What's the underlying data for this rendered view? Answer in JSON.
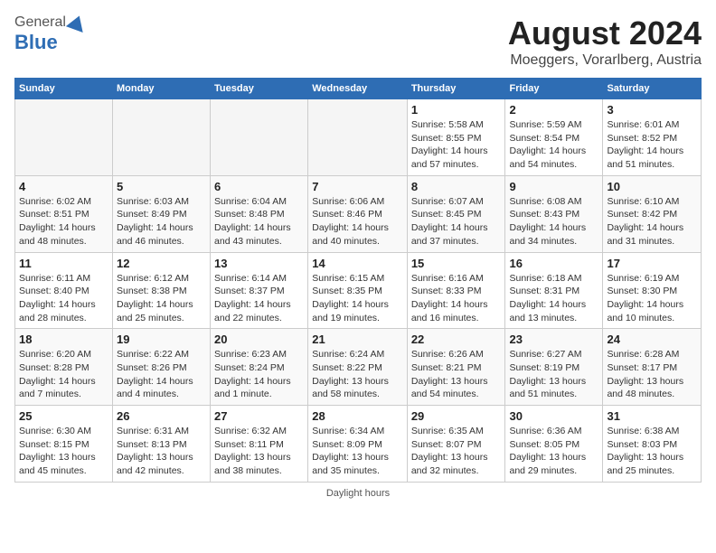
{
  "logo": {
    "general": "General",
    "blue": "Blue"
  },
  "title": "August 2024",
  "subtitle": "Moeggers, Vorarlberg, Austria",
  "days_of_week": [
    "Sunday",
    "Monday",
    "Tuesday",
    "Wednesday",
    "Thursday",
    "Friday",
    "Saturday"
  ],
  "weeks": [
    [
      {
        "num": "",
        "info": ""
      },
      {
        "num": "",
        "info": ""
      },
      {
        "num": "",
        "info": ""
      },
      {
        "num": "",
        "info": ""
      },
      {
        "num": "1",
        "info": "Sunrise: 5:58 AM\nSunset: 8:55 PM\nDaylight: 14 hours and 57 minutes."
      },
      {
        "num": "2",
        "info": "Sunrise: 5:59 AM\nSunset: 8:54 PM\nDaylight: 14 hours and 54 minutes."
      },
      {
        "num": "3",
        "info": "Sunrise: 6:01 AM\nSunset: 8:52 PM\nDaylight: 14 hours and 51 minutes."
      }
    ],
    [
      {
        "num": "4",
        "info": "Sunrise: 6:02 AM\nSunset: 8:51 PM\nDaylight: 14 hours and 48 minutes."
      },
      {
        "num": "5",
        "info": "Sunrise: 6:03 AM\nSunset: 8:49 PM\nDaylight: 14 hours and 46 minutes."
      },
      {
        "num": "6",
        "info": "Sunrise: 6:04 AM\nSunset: 8:48 PM\nDaylight: 14 hours and 43 minutes."
      },
      {
        "num": "7",
        "info": "Sunrise: 6:06 AM\nSunset: 8:46 PM\nDaylight: 14 hours and 40 minutes."
      },
      {
        "num": "8",
        "info": "Sunrise: 6:07 AM\nSunset: 8:45 PM\nDaylight: 14 hours and 37 minutes."
      },
      {
        "num": "9",
        "info": "Sunrise: 6:08 AM\nSunset: 8:43 PM\nDaylight: 14 hours and 34 minutes."
      },
      {
        "num": "10",
        "info": "Sunrise: 6:10 AM\nSunset: 8:42 PM\nDaylight: 14 hours and 31 minutes."
      }
    ],
    [
      {
        "num": "11",
        "info": "Sunrise: 6:11 AM\nSunset: 8:40 PM\nDaylight: 14 hours and 28 minutes."
      },
      {
        "num": "12",
        "info": "Sunrise: 6:12 AM\nSunset: 8:38 PM\nDaylight: 14 hours and 25 minutes."
      },
      {
        "num": "13",
        "info": "Sunrise: 6:14 AM\nSunset: 8:37 PM\nDaylight: 14 hours and 22 minutes."
      },
      {
        "num": "14",
        "info": "Sunrise: 6:15 AM\nSunset: 8:35 PM\nDaylight: 14 hours and 19 minutes."
      },
      {
        "num": "15",
        "info": "Sunrise: 6:16 AM\nSunset: 8:33 PM\nDaylight: 14 hours and 16 minutes."
      },
      {
        "num": "16",
        "info": "Sunrise: 6:18 AM\nSunset: 8:31 PM\nDaylight: 14 hours and 13 minutes."
      },
      {
        "num": "17",
        "info": "Sunrise: 6:19 AM\nSunset: 8:30 PM\nDaylight: 14 hours and 10 minutes."
      }
    ],
    [
      {
        "num": "18",
        "info": "Sunrise: 6:20 AM\nSunset: 8:28 PM\nDaylight: 14 hours and 7 minutes."
      },
      {
        "num": "19",
        "info": "Sunrise: 6:22 AM\nSunset: 8:26 PM\nDaylight: 14 hours and 4 minutes."
      },
      {
        "num": "20",
        "info": "Sunrise: 6:23 AM\nSunset: 8:24 PM\nDaylight: 14 hours and 1 minute."
      },
      {
        "num": "21",
        "info": "Sunrise: 6:24 AM\nSunset: 8:22 PM\nDaylight: 13 hours and 58 minutes."
      },
      {
        "num": "22",
        "info": "Sunrise: 6:26 AM\nSunset: 8:21 PM\nDaylight: 13 hours and 54 minutes."
      },
      {
        "num": "23",
        "info": "Sunrise: 6:27 AM\nSunset: 8:19 PM\nDaylight: 13 hours and 51 minutes."
      },
      {
        "num": "24",
        "info": "Sunrise: 6:28 AM\nSunset: 8:17 PM\nDaylight: 13 hours and 48 minutes."
      }
    ],
    [
      {
        "num": "25",
        "info": "Sunrise: 6:30 AM\nSunset: 8:15 PM\nDaylight: 13 hours and 45 minutes."
      },
      {
        "num": "26",
        "info": "Sunrise: 6:31 AM\nSunset: 8:13 PM\nDaylight: 13 hours and 42 minutes."
      },
      {
        "num": "27",
        "info": "Sunrise: 6:32 AM\nSunset: 8:11 PM\nDaylight: 13 hours and 38 minutes."
      },
      {
        "num": "28",
        "info": "Sunrise: 6:34 AM\nSunset: 8:09 PM\nDaylight: 13 hours and 35 minutes."
      },
      {
        "num": "29",
        "info": "Sunrise: 6:35 AM\nSunset: 8:07 PM\nDaylight: 13 hours and 32 minutes."
      },
      {
        "num": "30",
        "info": "Sunrise: 6:36 AM\nSunset: 8:05 PM\nDaylight: 13 hours and 29 minutes."
      },
      {
        "num": "31",
        "info": "Sunrise: 6:38 AM\nSunset: 8:03 PM\nDaylight: 13 hours and 25 minutes."
      }
    ]
  ],
  "footer": "Daylight hours"
}
